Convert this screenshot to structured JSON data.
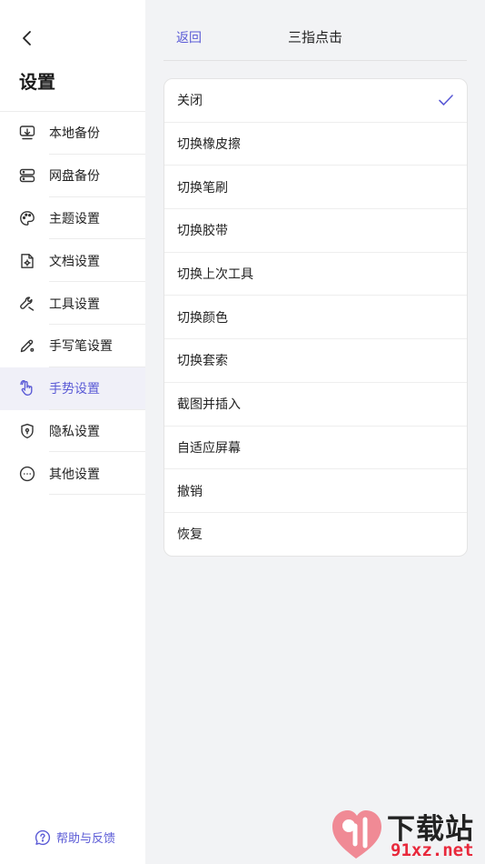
{
  "sidebar": {
    "back_icon": "chevron-left-icon",
    "title": "设置",
    "items": [
      {
        "label": "本地备份",
        "icon": "local-backup-icon",
        "active": false
      },
      {
        "label": "网盘备份",
        "icon": "cloud-drive-icon",
        "active": false
      },
      {
        "label": "主题设置",
        "icon": "palette-icon",
        "active": false
      },
      {
        "label": "文档设置",
        "icon": "document-gear-icon",
        "active": false
      },
      {
        "label": "工具设置",
        "icon": "wrench-icon",
        "active": false
      },
      {
        "label": "手写笔设置",
        "icon": "pen-gear-icon",
        "active": false
      },
      {
        "label": "手势设置",
        "icon": "hand-gesture-icon",
        "active": true
      },
      {
        "label": "隐私设置",
        "icon": "shield-icon",
        "active": false
      },
      {
        "label": "其他设置",
        "icon": "more-circle-icon",
        "active": false
      }
    ],
    "help_label": "帮助与反馈",
    "help_icon": "question-circle-icon"
  },
  "header": {
    "back_label": "返回",
    "title": "三指点击"
  },
  "options": [
    {
      "label": "关闭",
      "selected": true
    },
    {
      "label": "切换橡皮擦",
      "selected": false
    },
    {
      "label": "切换笔刷",
      "selected": false
    },
    {
      "label": "切换胶带",
      "selected": false
    },
    {
      "label": "切换上次工具",
      "selected": false
    },
    {
      "label": "切换颜色",
      "selected": false
    },
    {
      "label": "切换套索",
      "selected": false
    },
    {
      "label": "截图并插入",
      "selected": false
    },
    {
      "label": "自适应屏幕",
      "selected": false
    },
    {
      "label": "撤销",
      "selected": false
    },
    {
      "label": "恢复",
      "selected": false
    }
  ],
  "watermark": {
    "top_text": "下载站",
    "bottom_text": "91xz.net"
  },
  "colors": {
    "accent": "#5b5bd6",
    "active_bg": "#f0f0f8",
    "page_bg": "#f2f3f5",
    "watermark_red": "#e8283b"
  }
}
